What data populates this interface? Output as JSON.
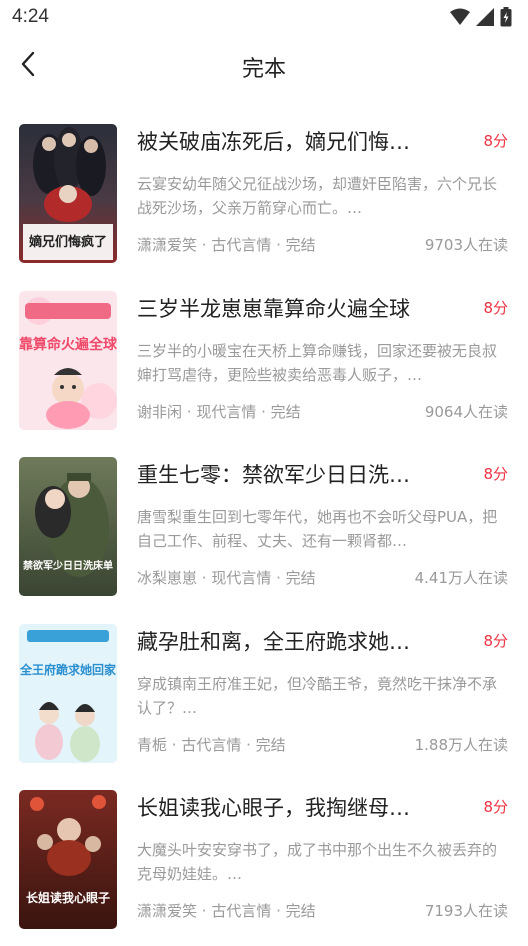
{
  "status_bar": {
    "time": "4:24"
  },
  "header": {
    "title": "完本"
  },
  "books": [
    {
      "title": "被关破庙冻死后，嫡兄们悔…",
      "score": "8分",
      "desc": "云宴安幼年随父兄征战沙场，却遭奸臣陷害，六个兄长战死沙场，父亲万箭穿心而亡。…",
      "author": "潇潇爱笑",
      "genre": "古代言情",
      "status": "完结",
      "readers": "9703人在读",
      "cover_text": "嫡兄们悔疯了"
    },
    {
      "title": "三岁半龙崽崽靠算命火遍全球",
      "score": "8分",
      "desc": "三岁半的小暖宝在天桥上算命赚钱，回家还要被无良叔婶打骂虐待，更险些被卖给恶毒人贩子，…",
      "author": "谢非闲",
      "genre": "现代言情",
      "status": "完结",
      "readers": "9064人在读",
      "cover_text": "靠算命火遍全球"
    },
    {
      "title": "重生七零：禁欲军少日日洗…",
      "score": "8分",
      "desc": "唐雪梨重生回到七零年代，她再也不会听父母PUA，把自己工作、前程、丈夫、还有一颗肾都…",
      "author": "冰梨崽崽",
      "genre": "现代言情",
      "status": "完结",
      "readers": "4.41万人在读",
      "cover_text": "禁欲军少日日洗床单"
    },
    {
      "title": "藏孕肚和离，全王府跪求她…",
      "score": "8分",
      "desc": "穿成镇南王府准王妃，但冷酷王爷，竟然吃干抹净不承认了？…",
      "author": "青栀",
      "genre": "古代言情",
      "status": "完结",
      "readers": "1.88万人在读",
      "cover_text": "全王府跪求她回家"
    },
    {
      "title": "长姐读我心眼子，我掏继母…",
      "score": "8分",
      "desc": "大魔头叶安安穿书了，成了书中那个出生不久被丢弃的克母奶娃娃。…",
      "author": "潇潇爱笑",
      "genre": "古代言情",
      "status": "完结",
      "readers": "7193人在读",
      "cover_text": "长姐读我心眼子"
    }
  ],
  "meta_separator": " · ",
  "colors": {
    "score": "#ee3344",
    "muted": "#9a9a9a",
    "title": "#222222"
  }
}
